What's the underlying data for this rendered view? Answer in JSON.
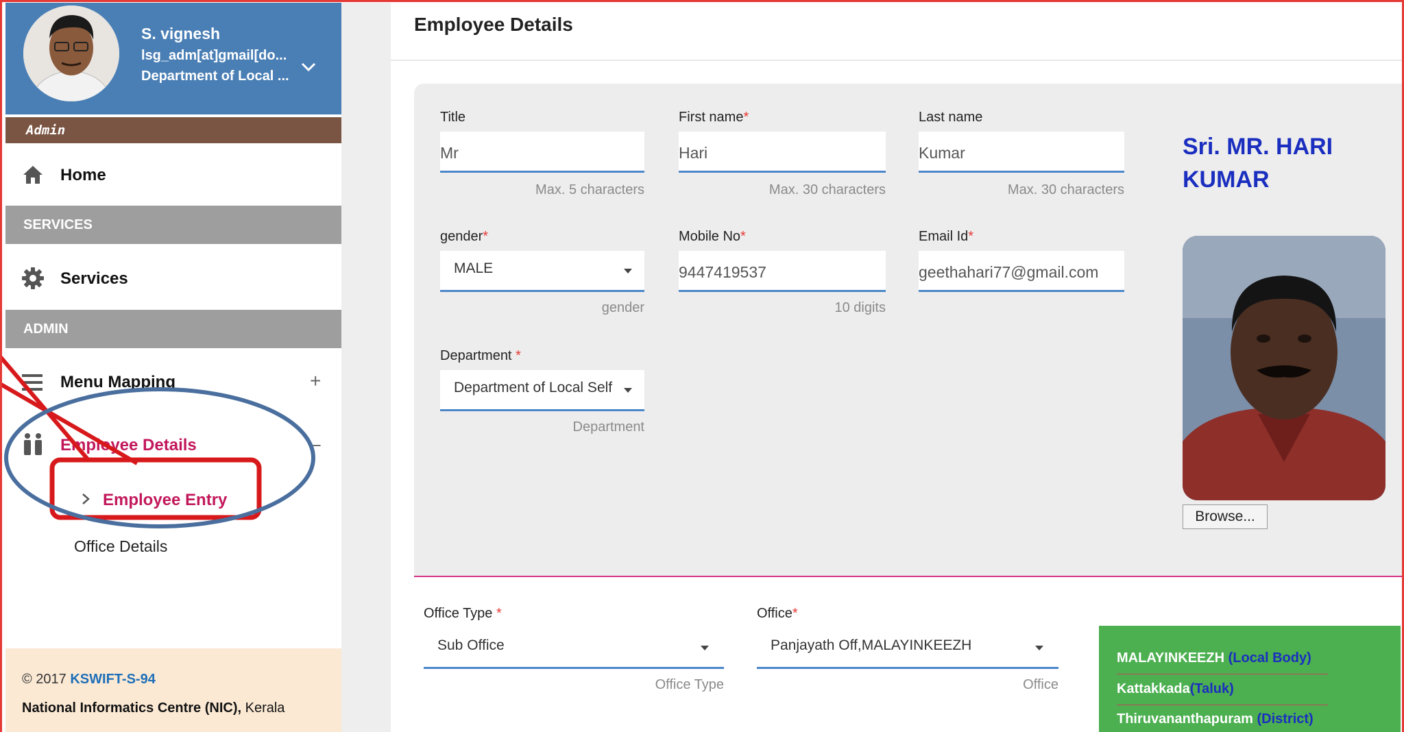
{
  "user": {
    "name": "S. vignesh",
    "email": "lsg_adm[at]gmail[do...",
    "department": "Department of Local ...",
    "role": "Admin"
  },
  "sidebar": {
    "home": "Home",
    "services_header": "SERVICES",
    "services": "Services",
    "admin_header": "ADMIN",
    "menu_mapping": "Menu Mapping",
    "menu_mapping_toggle": "+",
    "employee_details": "Employee Details",
    "employee_details_toggle": "–",
    "employee_entry": "Employee Entry",
    "office_details": "Office Details"
  },
  "footer": {
    "copyright": "© 2017",
    "app_code": "KSWIFT-S-94",
    "org": "National Informatics Centre (NIC),",
    "state": "Kerala"
  },
  "page": {
    "title": "Employee Details"
  },
  "form": {
    "title": {
      "label": "Title",
      "value": "Mr",
      "hint": "Max. 5 characters"
    },
    "first_name": {
      "label": "First name",
      "value": "Hari",
      "hint": "Max. 30 characters"
    },
    "last_name": {
      "label": "Last name",
      "value": "Kumar",
      "hint": "Max. 30 characters"
    },
    "gender": {
      "label": "gender",
      "value": "MALE",
      "hint": "gender"
    },
    "mobile": {
      "label": "Mobile No",
      "value": "9447419537",
      "hint": "10 digits"
    },
    "email": {
      "label": "Email Id",
      "value": "geethahari77@gmail.com"
    },
    "department": {
      "label": "Department ",
      "value": "Department of Local Self",
      "hint": "Department"
    },
    "office_type": {
      "label": "Office Type ",
      "value": "Sub Office",
      "hint": "Office Type"
    },
    "office": {
      "label": "Office",
      "value": "Panjayath Off,MALAYINKEEZH",
      "hint": "Office"
    },
    "required_mark": "*"
  },
  "profile_card": {
    "full_name": "Sri. MR. HARI KUMAR",
    "browse_label": "Browse..."
  },
  "location": {
    "local_body": "MALAYINKEEZH",
    "local_body_tag": "(Local Body)",
    "taluk": "Kattakkada",
    "taluk_tag": "(Taluk)",
    "district": "Thiruvananthapuram",
    "district_tag": "(District)"
  },
  "colors": {
    "sidebar_header": "#4a7fb5",
    "role_bar": "#7b5543",
    "active_menu": "#c2185b",
    "input_underline": "#4a86c8",
    "name_highlight": "#1a2ebf",
    "location_box": "#4caf50",
    "annotation_red": "#d7191c",
    "annotation_blue": "#4a6f9e"
  }
}
